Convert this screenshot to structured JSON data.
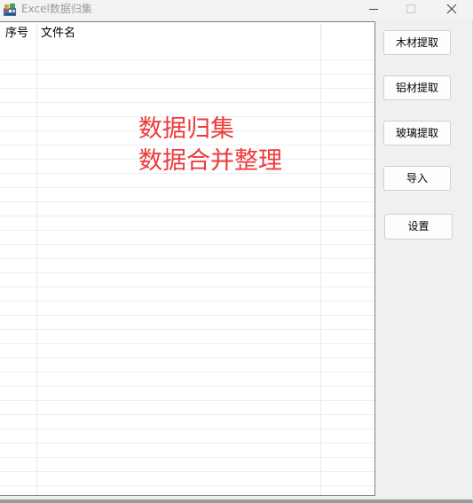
{
  "window": {
    "title": "Excel数据归集",
    "icon": "excel-app-icon",
    "controls": {
      "minimize": "minimize-icon",
      "maximize": "maximize-icon",
      "close": "close-icon"
    }
  },
  "list": {
    "columns": [
      "序号",
      "文件名"
    ],
    "rows": []
  },
  "overlay": {
    "line1": "数据归集",
    "line2": "数据合并整理",
    "color": "#ee3b3b"
  },
  "buttons": {
    "wood": "木材提取",
    "aluminum": "铝材提取",
    "glass": "玻璃提取",
    "import": "导入",
    "settings": "设置"
  }
}
